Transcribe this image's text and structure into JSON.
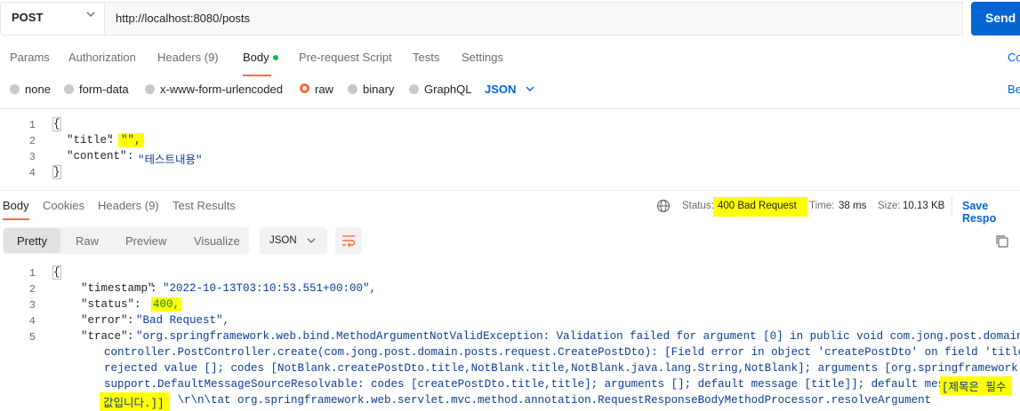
{
  "request": {
    "method": "POST",
    "url": "http://localhost:8080/posts",
    "send_label": "Send"
  },
  "request_tabs": {
    "params": "Params",
    "authorization": "Authorization",
    "headers": "Headers (9)",
    "body": "Body",
    "pre_request": "Pre-request Script",
    "tests": "Tests",
    "settings": "Settings",
    "right_link": "Co"
  },
  "body_modes": {
    "none": "none",
    "form_data": "form-data",
    "urlencoded": "x-www-form-urlencoded",
    "raw": "raw",
    "binary": "binary",
    "graphql": "GraphQL",
    "format": "JSON",
    "beautify": "Be"
  },
  "request_body": {
    "line_numbers": [
      "1",
      "2",
      "3",
      "4"
    ],
    "l1": "{",
    "l2_key": "\"title\"",
    "l2_colon": ": ",
    "l2_val": "\"\",",
    "l3_key": "\"content\"",
    "l3_colon": ": ",
    "l3_val": "\"테스트내용\"",
    "l4": "}"
  },
  "response_tabs": {
    "body": "Body",
    "cookies": "Cookies",
    "headers": "Headers (9)",
    "test_results": "Test Results"
  },
  "response_meta": {
    "status_label": "Status:",
    "status_value": "400 Bad Request",
    "time_label": "Time:",
    "time_value": "38 ms",
    "size_label": "Size:",
    "size_value": "10.13 KB",
    "save_response": "Save Respo"
  },
  "view_modes": {
    "pretty": "Pretty",
    "raw": "Raw",
    "preview": "Preview",
    "visualize": "Visualize",
    "format": "JSON"
  },
  "response_body": {
    "line_numbers": [
      "1",
      "2",
      "3",
      "4",
      "5"
    ],
    "l1": "{",
    "timestamp_key": "\"timestamp\"",
    "timestamp_val": "\"2022-10-13T03:10:53.551+00:00\",",
    "status_key": "\"status\"",
    "status_val": "400,",
    "error_key": "\"error\"",
    "error_val": "\"Bad Request\",",
    "trace_key": "\"trace\"",
    "trace_line1": "\"org.springframework.web.bind.MethodArgumentNotValidException: Validation failed for argument [0] in public void com.jong.post.domain.post",
    "trace_line2": "controller.PostController.create(com.jong.post.domain.posts.request.CreatePostDto): [Field error in object 'createPostDto' on field 'title':",
    "trace_line3": "rejected value []; codes [NotBlank.createPostDto.title,NotBlank.title,NotBlank.java.lang.String,NotBlank]; arguments [org.springframework.conte",
    "trace_line4": "support.DefaultMessageSourceResolvable: codes [createPostDto.title,title]; arguments []; default message [title]]; default message ",
    "trace_line4_hl": "[제목은 필수",
    "trace_line5_hl": "값입니다.]]",
    "trace_line5": " \\r\\n\\tat org.springframework.web.servlet.mvc.method.annotation.RequestResponseBodyMethodProcessor.resolveArgument"
  },
  "colors": {
    "accent": "#ff6c37",
    "link": "#0265d2",
    "highlight": "#ffff00",
    "string": "#0b3d91"
  },
  "icons": [
    "chevron-down-icon",
    "globe-icon",
    "wrap-lines-icon",
    "copy-icon"
  ]
}
